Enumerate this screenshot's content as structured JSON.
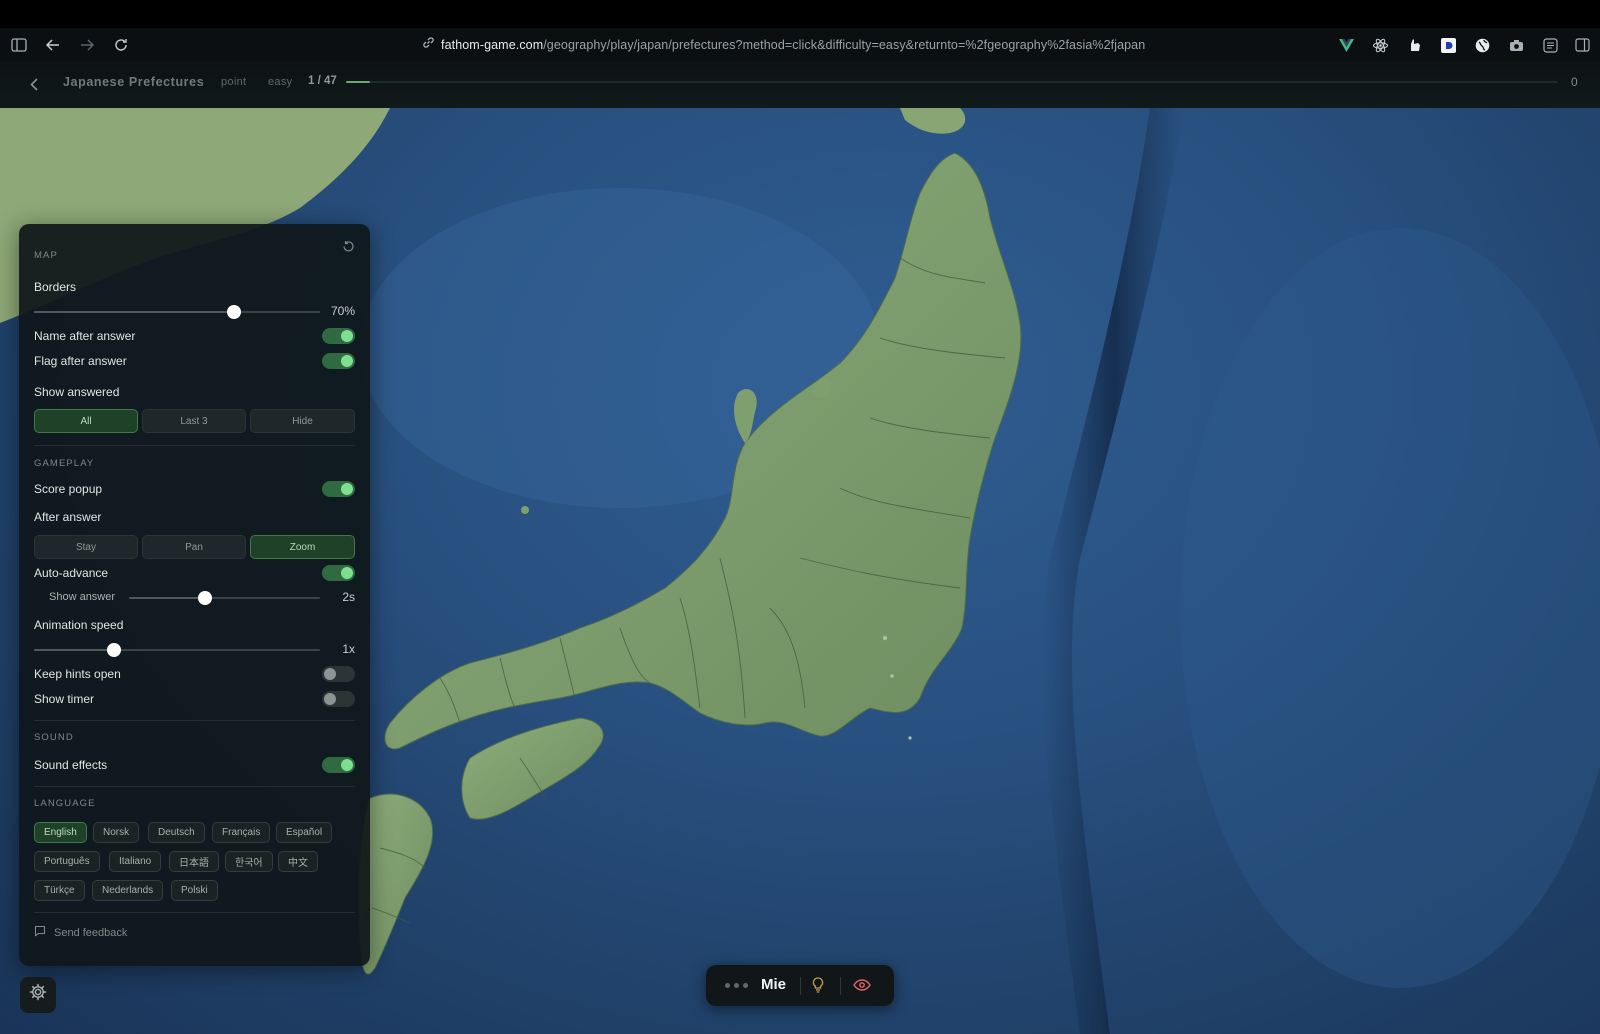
{
  "browser": {
    "url_domain": "fathom-game.com",
    "url_path": "/geography/play/japan/prefectures?method=click&difficulty=easy&returnto=%2fgeography%2fasia%2fjapan",
    "icons_left": [
      "sidebar-icon",
      "back-arrow-icon",
      "forward-arrow-icon",
      "reload-icon"
    ],
    "extension_icons": [
      "vue-extension-icon",
      "react-extension-icon",
      "hand-extension-icon",
      "square-d-extension-icon",
      "globe-extension-icon",
      "camera-extension-icon",
      "reader-icon",
      "split-view-icon"
    ]
  },
  "game": {
    "title": "Japanese Prefectures",
    "mode": "point",
    "difficulty": "easy",
    "progress_text": "1 / 47",
    "progress_fraction": 0.02,
    "score": "0"
  },
  "settings": {
    "map_section": "MAP",
    "borders_label": "Borders",
    "borders_value_text": "70%",
    "borders_value": 0.7,
    "name_after_answer_label": "Name after answer",
    "name_after_answer_on": true,
    "flag_after_answer_label": "Flag after answer",
    "flag_after_answer_on": true,
    "show_answered_label": "Show answered",
    "show_answered_options": [
      "All",
      "Last 3",
      "Hide"
    ],
    "show_answered_selected": "All",
    "gameplay_section": "GAMEPLAY",
    "score_popup_label": "Score popup",
    "score_popup_on": true,
    "after_answer_label": "After answer",
    "after_answer_options": [
      "Stay",
      "Pan",
      "Zoom"
    ],
    "after_answer_selected": "Zoom",
    "auto_advance_label": "Auto-advance",
    "auto_advance_on": true,
    "show_answer_label": "Show answer",
    "show_answer_value_text": "2s",
    "show_answer_value": 0.4,
    "animation_speed_label": "Animation speed",
    "animation_speed_value_text": "1x",
    "animation_speed_value": 0.28,
    "keep_hints_open_label": "Keep hints open",
    "keep_hints_open_on": false,
    "show_timer_label": "Show timer",
    "show_timer_on": false,
    "sound_section": "SOUND",
    "sound_effects_label": "Sound effects",
    "sound_effects_on": true,
    "language_section": "LANGUAGE",
    "languages": [
      "English",
      "Norsk",
      "Deutsch",
      "Français",
      "Español",
      "Português",
      "Italiano",
      "日本語",
      "한국어",
      "中文",
      "Türkçe",
      "Nederlands",
      "Polski"
    ],
    "language_selected": "English",
    "feedback_label": "Send feedback"
  },
  "prompt": {
    "target_name": "Mie"
  },
  "colors": {
    "accent_green": "#7ee08e",
    "toggle_on_bg": "#2f6a40",
    "ocean": "#28507f",
    "land": "#7e9e6e",
    "hint_yellow": "#c9a34a",
    "eye_red": "#e0656b"
  }
}
